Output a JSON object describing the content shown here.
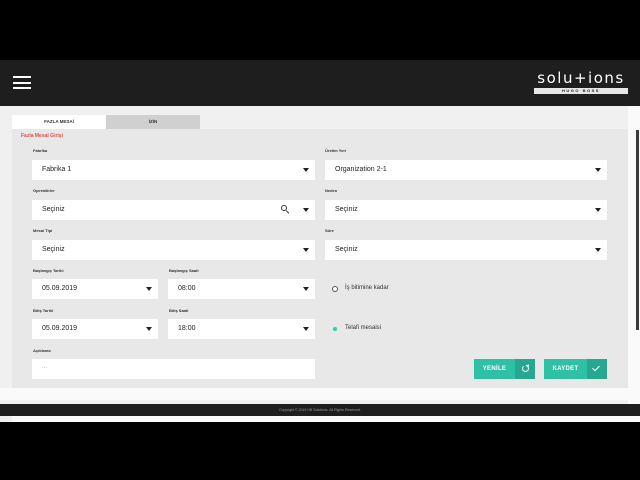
{
  "header": {
    "logo_text": "solu+ions",
    "logo_sub": "HUGO BOSS"
  },
  "tabs": [
    {
      "label": "FAZLA MESAİ",
      "active": true
    },
    {
      "label": "İZİN",
      "active": false
    }
  ],
  "form": {
    "title": "Fazla Mesai Girişi",
    "fabrika": {
      "label": "Fabrika",
      "value": "Fabrika 1"
    },
    "uretim_yeri": {
      "label": "Üretim Yeri",
      "value": "Organization 2-1"
    },
    "operatorler": {
      "label": "Operatörler",
      "value": "Seçiniz"
    },
    "neden": {
      "label": "Neden",
      "value": "Seçiniz"
    },
    "mesai_tipi": {
      "label": "Mesai Tipi",
      "value": "Seçiniz"
    },
    "sure": {
      "label": "Süre",
      "value": "Seçiniz"
    },
    "baslangic_tarihi": {
      "label": "Başlangıç Tarihi",
      "value": "05.09.2019"
    },
    "baslangic_saati": {
      "label": "Başlangıç Saati",
      "value": "08:00"
    },
    "bitis_tarihi": {
      "label": "Bitiş Tarihi",
      "value": "05.09.2019"
    },
    "bitis_saati": {
      "label": "Bitiş Saati",
      "value": "18:00"
    },
    "radio_is_bitimine": {
      "label": "İş bitimine kadar",
      "selected": false
    },
    "radio_telafi": {
      "label": "Telafi mesaisi",
      "selected": true
    },
    "aciklama": {
      "label": "Açıklama",
      "placeholder": "..."
    }
  },
  "buttons": {
    "yenile": "YENİLE",
    "kaydet": "KAYDET"
  },
  "footer": {
    "copyright": "Copyright © 2019 HB Solutions. All Rights Reserved."
  },
  "colors": {
    "accent": "#2fc1a6",
    "title_red": "#e2504c",
    "topbar": "#1e1e1e"
  }
}
